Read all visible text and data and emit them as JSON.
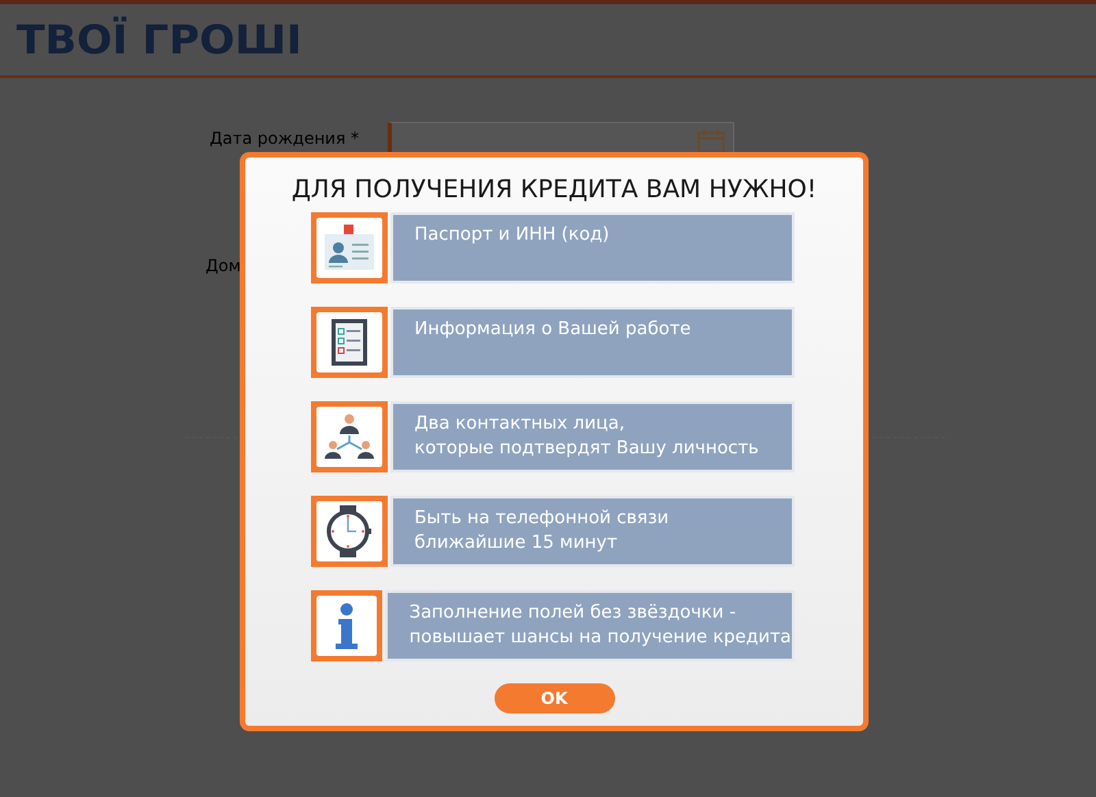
{
  "header": {
    "logo": "ТВОЇ ГРОШІ"
  },
  "form": {
    "fields": [
      {
        "kind": "date",
        "label": "Дата рождения",
        "required_mark": "*"
      },
      {
        "kind": "label-only",
        "label": "Дом"
      }
    ]
  },
  "modal": {
    "title": "ДЛЯ ПОЛУЧЕНИЯ КРЕДИТА ВАМ НУЖНО!",
    "items": [
      {
        "kind": "id-card",
        "lines": [
          "Паспорт и ИНН (код)"
        ]
      },
      {
        "kind": "clipboard",
        "lines": [
          "Информация о Вашей работе"
        ]
      },
      {
        "kind": "people",
        "lines": [
          "Два контактных лица,",
          "которые подтвердят Вашу личность"
        ]
      },
      {
        "kind": "watch",
        "lines": [
          "Быть на телефонной связи",
          "ближайшие 15 минут"
        ]
      },
      {
        "kind": "info",
        "lines": [
          "Заполнение полей без звёздочки -",
          "повышает шансы на получение кредита"
        ]
      }
    ],
    "button": "OK"
  }
}
